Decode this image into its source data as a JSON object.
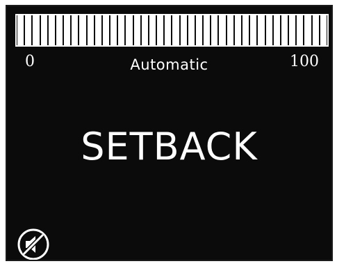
{
  "level_bar": {
    "level_fraction": 1.0,
    "segments": 40
  },
  "scale": {
    "min_label": "0",
    "max_label": "100"
  },
  "mode": {
    "label": "Automatic"
  },
  "status": {
    "text": "SETBACK"
  },
  "icons": {
    "mute": "speaker-muted-icon"
  },
  "colors": {
    "background": "#0b0b0b",
    "foreground": "#ffffff"
  }
}
